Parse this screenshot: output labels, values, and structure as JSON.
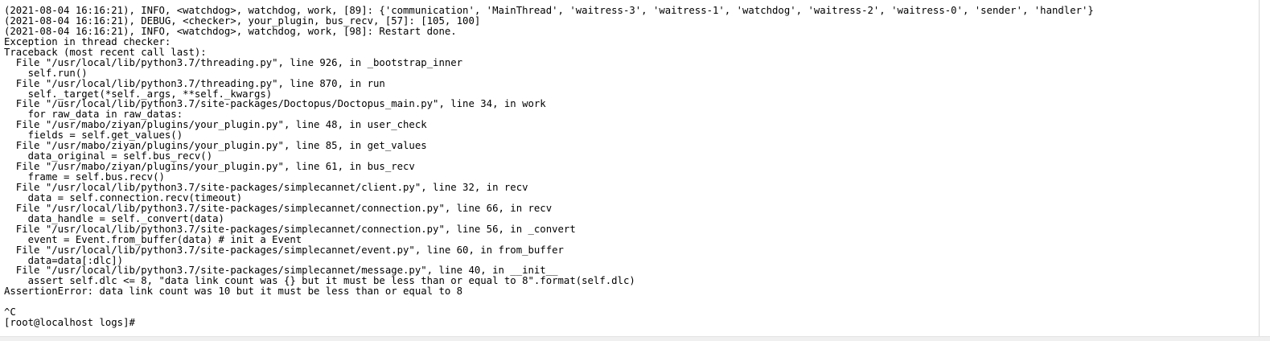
{
  "terminal": {
    "lines": [
      "(2021-08-04 16:16:21), INFO, <watchdog>, watchdog, work, [89]: {'communication', 'MainThread', 'waitress-3', 'waitress-1', 'watchdog', 'waitress-2', 'waitress-0', 'sender', 'handler'}",
      "(2021-08-04 16:16:21), DEBUG, <checker>, your_plugin, bus_recv, [57]: [105, 100]",
      "(2021-08-04 16:16:21), INFO, <watchdog>, watchdog, work, [98]: Restart done.",
      "Exception in thread checker:",
      "Traceback (most recent call last):",
      "  File \"/usr/local/lib/python3.7/threading.py\", line 926, in _bootstrap_inner",
      "    self.run()",
      "  File \"/usr/local/lib/python3.7/threading.py\", line 870, in run",
      "    self._target(*self._args, **self._kwargs)",
      "  File \"/usr/local/lib/python3.7/site-packages/Doctopus/Doctopus_main.py\", line 34, in work",
      "    for raw_data in raw_datas:",
      "  File \"/usr/mabo/ziyan/plugins/your_plugin.py\", line 48, in user_check",
      "    fields = self.get_values()",
      "  File \"/usr/mabo/ziyan/plugins/your_plugin.py\", line 85, in get_values",
      "    data_original = self.bus_recv()",
      "  File \"/usr/mabo/ziyan/plugins/your_plugin.py\", line 61, in bus_recv",
      "    frame = self.bus.recv()",
      "  File \"/usr/local/lib/python3.7/site-packages/simplecannet/client.py\", line 32, in recv",
      "    data = self.connection.recv(timeout)",
      "  File \"/usr/local/lib/python3.7/site-packages/simplecannet/connection.py\", line 66, in recv",
      "    data_handle = self._convert(data)",
      "  File \"/usr/local/lib/python3.7/site-packages/simplecannet/connection.py\", line 56, in _convert",
      "    event = Event.from_buffer(data) # init a Event",
      "  File \"/usr/local/lib/python3.7/site-packages/simplecannet/event.py\", line 60, in from_buffer",
      "    data=data[:dlc])",
      "  File \"/usr/local/lib/python3.7/site-packages/simplecannet/message.py\", line 40, in __init__",
      "    assert self.dlc <= 8, \"data link count was {} but it must be less than or equal to 8\".format(self.dlc)",
      "AssertionError: data link count was 10 but it must be less than or equal to 8",
      "",
      "^C",
      "[root@localhost logs]#"
    ]
  }
}
